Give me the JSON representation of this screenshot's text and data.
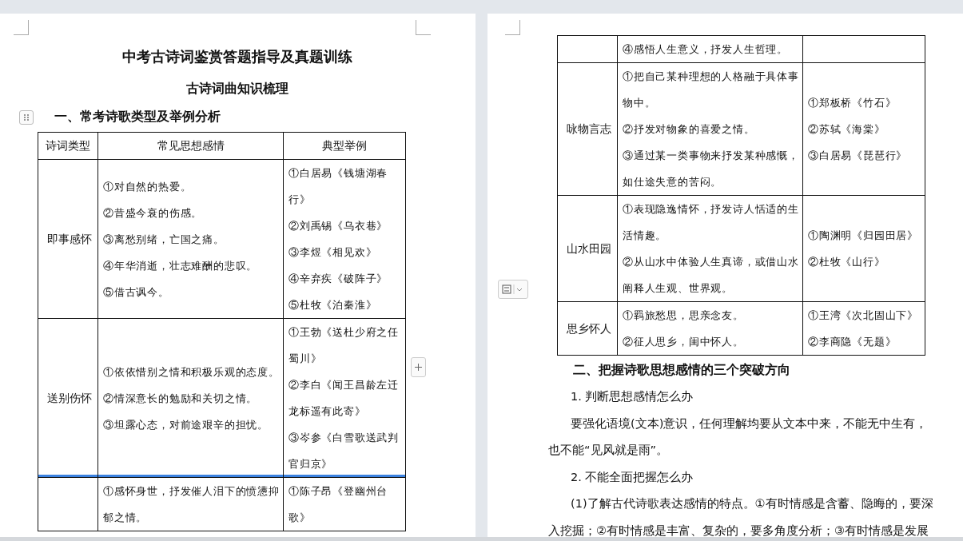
{
  "left_page": {
    "title": "中考古诗词鉴赏答题指导及真题训练",
    "subtitle": "古诗词曲知识梳理",
    "heading": "一、常考诗歌类型及举例分析",
    "table": {
      "columns": [
        "诗词类型",
        "常见思想感情",
        "典型举例"
      ],
      "rows": [
        {
          "category": "即事感怀",
          "feelings": [
            "①对自然的热爱。",
            "②昔盛今衰的伤感。",
            "③离愁别绪，亡国之痛。",
            "④年华消逝，壮志难酬的悲叹。",
            "⑤借古讽今。"
          ],
          "examples": [
            "①白居易《钱塘湖春行》",
            "②刘禹锡《乌衣巷》",
            "③李煜《相见欢》",
            "④辛弃疾《破阵子》",
            "⑤杜牧《泊秦淮》"
          ],
          "marked": false
        },
        {
          "category": "送别伤怀",
          "feelings": [
            "①依依惜别之情和积极乐观的态度。",
            "②情深意长的勉励和关切之情。",
            "③坦露心态，对前途艰辛的担忧。"
          ],
          "examples": [
            "①王勃《送杜少府之任蜀川》",
            "②李白《闻王昌龄左迁龙标遥有此寄》",
            "③岑参《白雪歌送武判官归京》"
          ],
          "marked": true
        },
        {
          "feelings": [
            "①感怀身世，抒发催人泪下的愤懑抑郁之情。"
          ],
          "examples": [
            "①陈子昂《登幽州台歌》"
          ],
          "marked": false
        }
      ]
    }
  },
  "right_page": {
    "table": {
      "rows": [
        {
          "feelings": [
            "④感悟人生意义，抒发人生哲理。"
          ],
          "examples": [],
          "marked": false
        },
        {
          "category": "咏物言志",
          "feelings": [
            "①把自己某种理想的人格融于具体事物中。",
            "②抒发对物象的喜爱之情。",
            "③通过某一类事物来抒发某种感慨，如仕途失意的苦闷。"
          ],
          "examples": [
            "①郑板桥《竹石》",
            "②苏轼《海棠》",
            "③白居易《琵琶行》"
          ],
          "marked": false
        },
        {
          "category": "山水田园",
          "feelings": [
            "①表现隐逸情怀，抒发诗人恬适的生活情趣。",
            "②从山水中体验人生真谛，或借山水阐释人生观、世界观。"
          ],
          "examples": [
            "①陶渊明《归园田居》",
            "②杜牧《山行》"
          ],
          "marked": false
        },
        {
          "category": "思乡怀人",
          "feelings": [
            "①羁旅愁思，思亲念友。",
            "②征人思乡，闺中怀人。"
          ],
          "examples": [
            "①王湾《次北固山下》",
            "②李商隐《无题》"
          ],
          "marked": false
        }
      ]
    },
    "heading": "二、把握诗歌思想感情的三个突破方向",
    "paragraphs": [
      {
        "text": "1. 判断思想感情怎么办"
      },
      {
        "text": "要强化语境(文本)意识，任何理解均要从文本中来，不能无中生有，也不能“见风就是雨”。"
      },
      {
        "text": "2. 不能全面把握怎么办"
      },
      {
        "text": "(1)了解古代诗歌表达感情的特点。①有时情感是含蓄、隐晦的，要深入挖掘；②有时情感是丰富、复杂的，要多角度分析；③有时情感是发展"
      }
    ]
  }
}
